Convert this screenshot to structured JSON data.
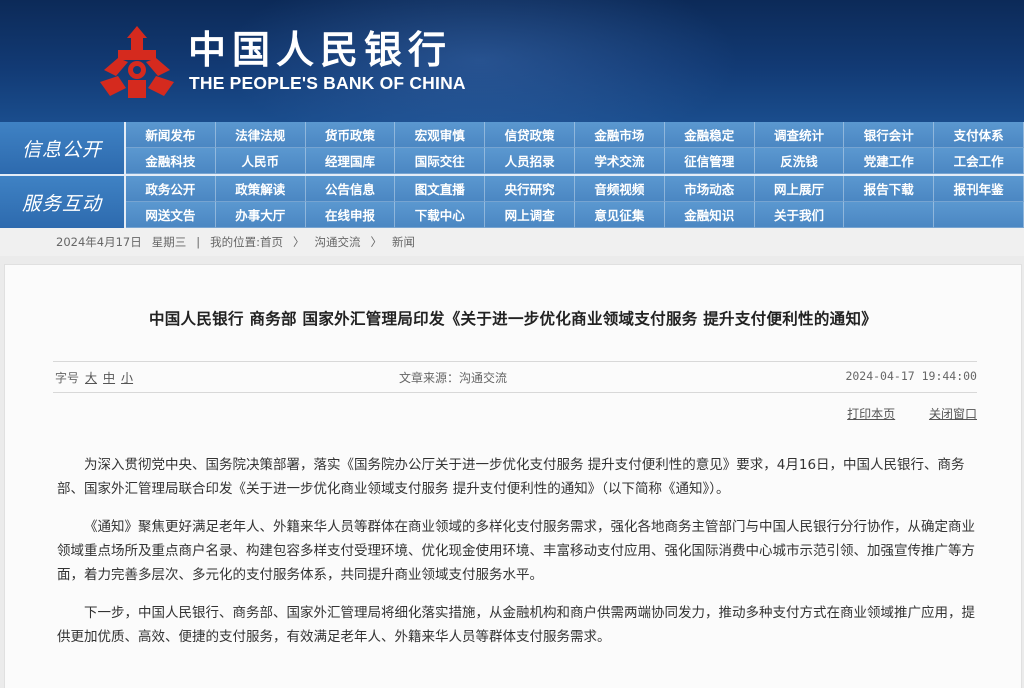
{
  "header": {
    "title_cn": "中国人民银行",
    "title_en": "THE PEOPLE'S BANK OF CHINA",
    "logo_icon": "pboc-emblem-icon",
    "logo_color": "#d52a1e"
  },
  "nav": {
    "info_title": "信息公开",
    "info_items": [
      "新闻发布",
      "法律法规",
      "货币政策",
      "宏观审慎",
      "信贷政策",
      "金融市场",
      "金融稳定",
      "调查统计",
      "银行会计",
      "支付体系",
      "金融科技",
      "人民币",
      "经理国库",
      "国际交往",
      "人员招录",
      "学术交流",
      "征信管理",
      "反洗钱",
      "党建工作",
      "工会工作"
    ],
    "service_title": "服务互动",
    "service_items": [
      "政务公开",
      "政策解读",
      "公告信息",
      "图文直播",
      "央行研究",
      "音频视频",
      "市场动态",
      "网上展厅",
      "报告下载",
      "报刊年鉴",
      "网送文告",
      "办事大厅",
      "在线申报",
      "下载中心",
      "网上调查",
      "意见征集",
      "金融知识",
      "关于我们"
    ]
  },
  "breadcrumb": {
    "date": "2024年4月17日",
    "weekday": "星期三",
    "sep": "|",
    "location_label": "我的位置:",
    "home": "首页",
    "arrow": "〉",
    "section": "沟通交流",
    "current": "新闻"
  },
  "article": {
    "title": "中国人民银行  商务部  国家外汇管理局印发《关于进一步优化商业领域支付服务  提升支付便利性的通知》",
    "font_label": "字号",
    "font_large": "大",
    "font_medium": "中",
    "font_small": "小",
    "source": "文章来源：沟通交流",
    "datetime": "2024-04-17  19:44:00",
    "print": "打印本页",
    "close": "关闭窗口",
    "paragraphs": [
      "为深入贯彻党中央、国务院决策部署，落实《国务院办公厅关于进一步优化支付服务 提升支付便利性的意见》要求，4月16日，中国人民银行、商务部、国家外汇管理局联合印发《关于进一步优化商业领域支付服务 提升支付便利性的通知》（以下简称《通知》）。",
      "《通知》聚焦更好满足老年人、外籍来华人员等群体在商业领域的多样化支付服务需求，强化各地商务主管部门与中国人民银行分行协作，从确定商业领域重点场所及重点商户名录、构建包容多样支付受理环境、优化现金使用环境、丰富移动支付应用、强化国际消费中心城市示范引领、加强宣传推广等方面，着力完善多层次、多元化的支付服务体系，共同提升商业领域支付服务水平。",
      "下一步，中国人民银行、商务部、国家外汇管理局将细化落实措施，从金融机构和商户供需两端协同发力，推动多种支付方式在商业领域推广应用，提供更加优质、高效、便捷的支付服务，有效满足老年人、外籍来华人员等群体支付服务需求。"
    ]
  }
}
